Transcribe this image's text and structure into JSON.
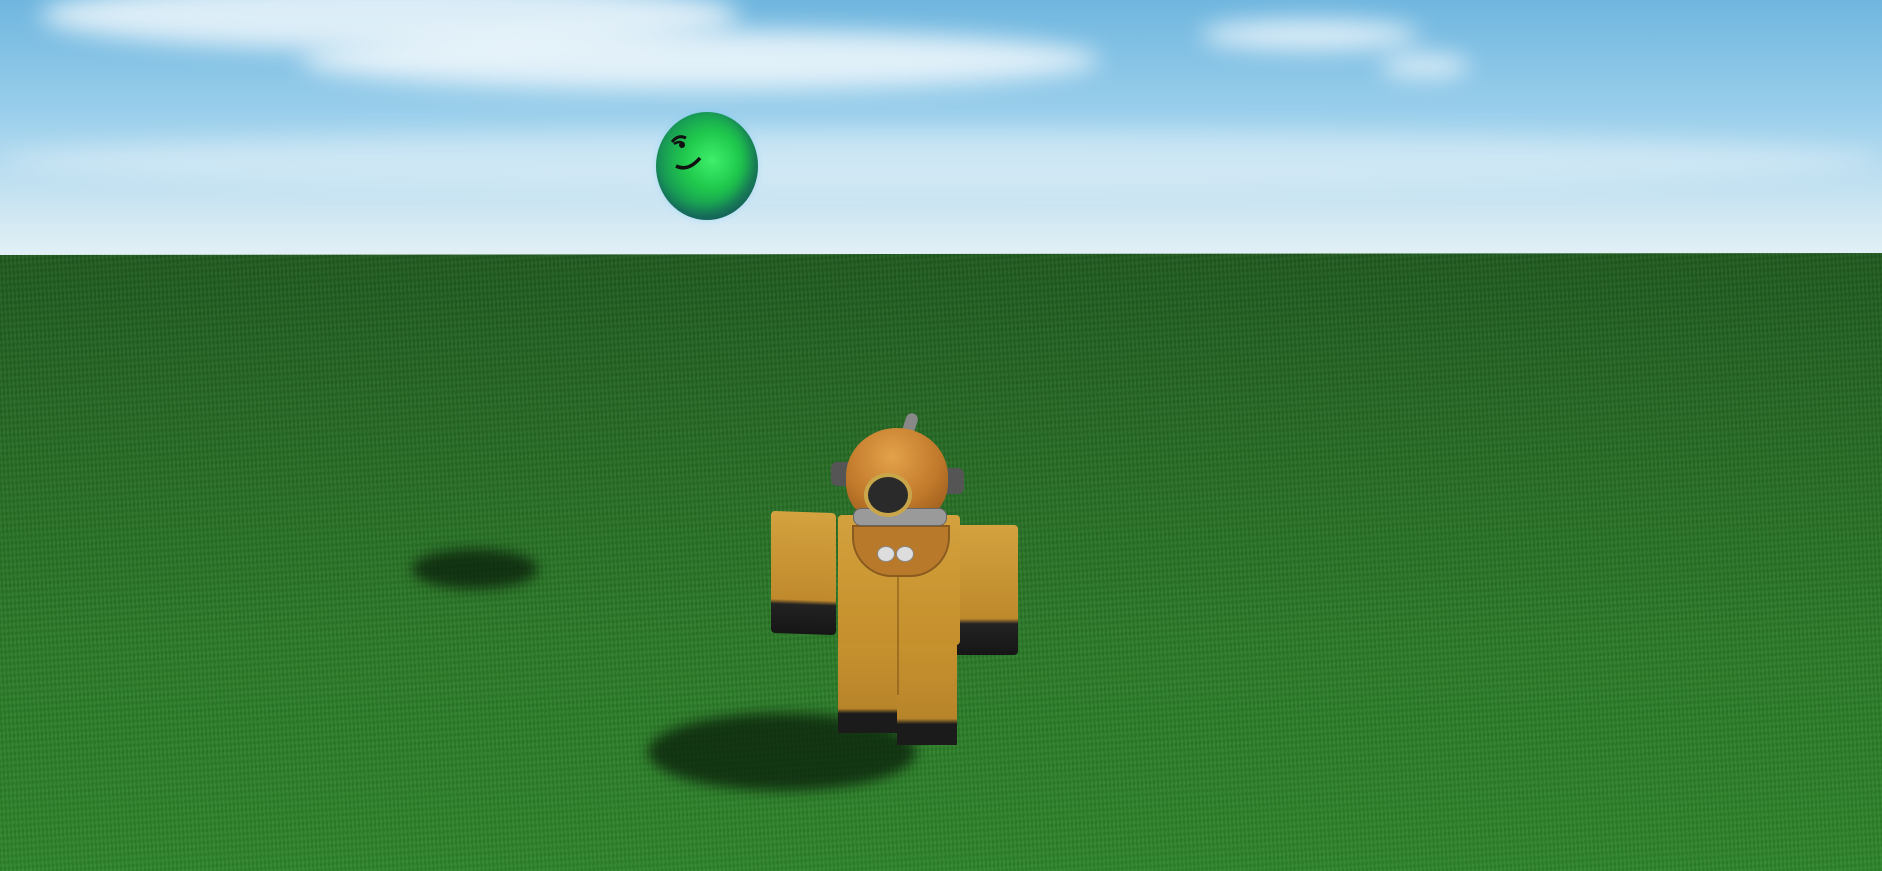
{
  "scene": {
    "colors": {
      "sky_top": "#6fb6df",
      "sky_horizon": "#e5f1f6",
      "grass": "#2b7a28",
      "ball_green": "#1fc84c",
      "avatar_suit": "#d3a13d",
      "helmet_copper": "#c0782a"
    },
    "objects": [
      "green-face-ball",
      "diver-avatar",
      "ball-shadow",
      "avatar-shadow"
    ]
  }
}
